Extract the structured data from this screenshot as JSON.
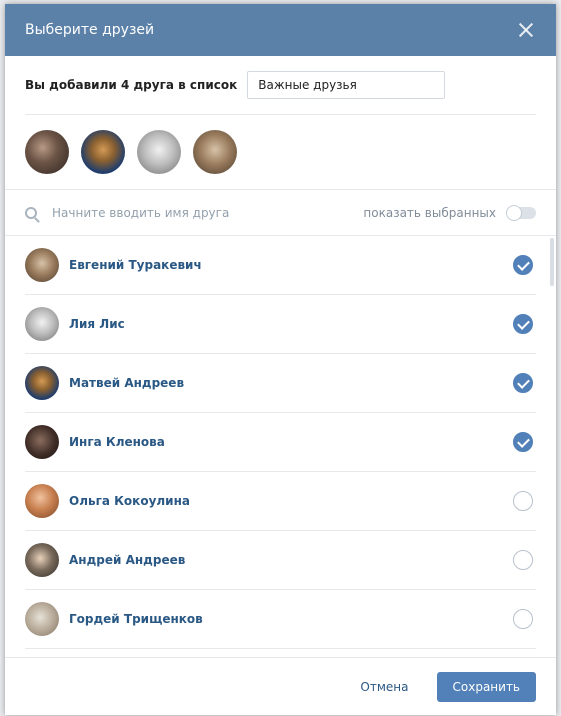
{
  "header": {
    "title": "Выберите друзей"
  },
  "list_row": {
    "label": "Вы добавили 4 друга в список",
    "list_name": "Важные друзья"
  },
  "search": {
    "placeholder": "Начните вводить имя друга",
    "show_selected_label": "показать выбранных",
    "show_selected_on": false
  },
  "friends": [
    {
      "name": "Евгений Туракевич",
      "selected": true
    },
    {
      "name": "Лия Лис",
      "selected": true
    },
    {
      "name": "Матвей Андреев",
      "selected": true
    },
    {
      "name": "Инга Кленова",
      "selected": true
    },
    {
      "name": "Ольга Кокоулина",
      "selected": false
    },
    {
      "name": "Андрей Андреев",
      "selected": false
    },
    {
      "name": "Гордей Трищенков",
      "selected": false
    }
  ],
  "footer": {
    "cancel_label": "Отмена",
    "save_label": "Сохранить"
  },
  "colors": {
    "header_bg": "#5b81a8",
    "accent": "#5181b8",
    "link": "#2a5885"
  }
}
